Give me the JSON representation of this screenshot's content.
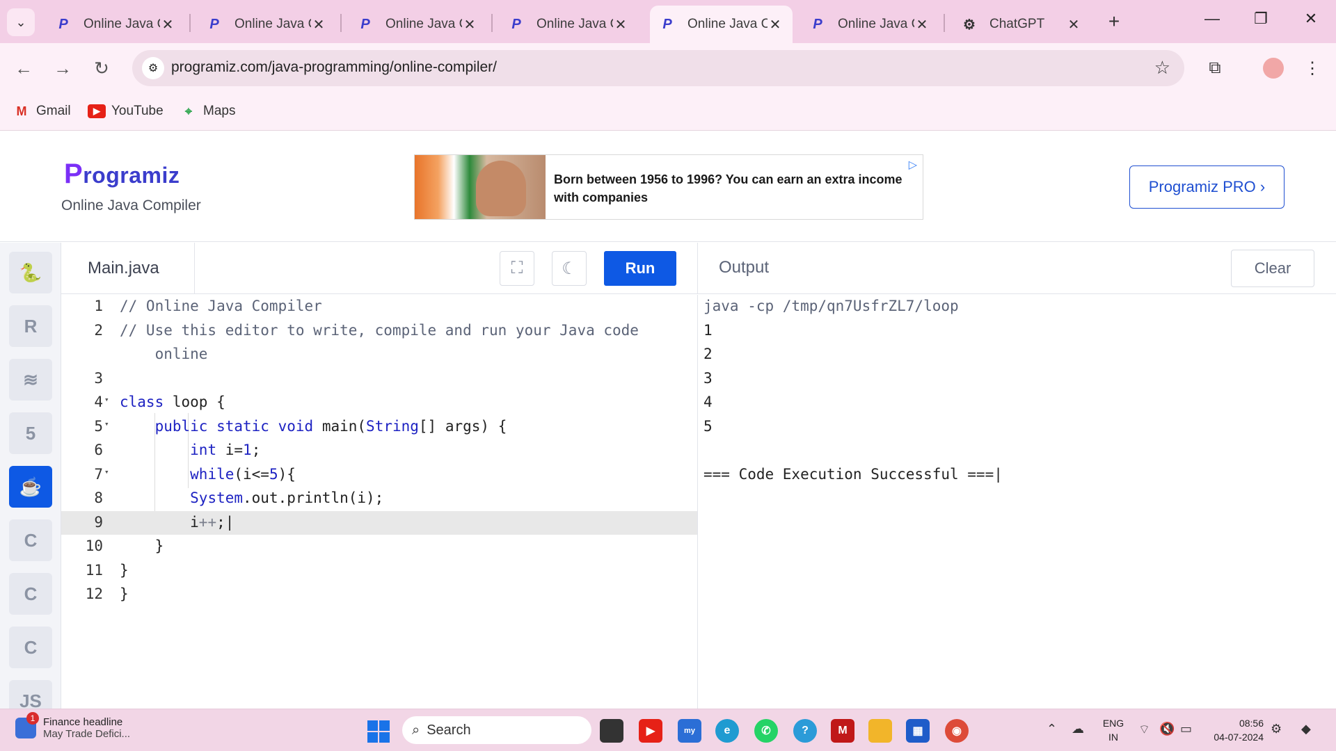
{
  "browser": {
    "tabs": [
      {
        "title": "Online Java C",
        "active": false
      },
      {
        "title": "Online Java C",
        "active": false
      },
      {
        "title": "Online Java C",
        "active": false
      },
      {
        "title": "Online Java C",
        "active": false
      },
      {
        "title": "Online Java C",
        "active": true
      },
      {
        "title": "Online Java C",
        "active": false
      },
      {
        "title": "ChatGPT",
        "active": false
      }
    ],
    "url": "programiz.com/java-programming/online-compiler/",
    "bookmarks": [
      {
        "label": "Gmail",
        "icon": "gmail-icon"
      },
      {
        "label": "YouTube",
        "icon": "youtube-icon"
      },
      {
        "label": "Maps",
        "icon": "maps-icon"
      }
    ]
  },
  "site": {
    "logo": "rogramiz",
    "logo_initial": "P",
    "subtitle": "Online Java Compiler",
    "ad_text": "Born between 1956 to 1996? You can earn an extra income with companies",
    "pro_button": "Programiz PRO ›"
  },
  "rail": {
    "items": [
      {
        "name": "python",
        "glyph": "🐍",
        "active": false
      },
      {
        "name": "r",
        "glyph": "R",
        "active": false
      },
      {
        "name": "sql",
        "glyph": "≋",
        "active": false
      },
      {
        "name": "html",
        "glyph": "5",
        "active": false
      },
      {
        "name": "java",
        "glyph": "☕",
        "active": true
      },
      {
        "name": "c",
        "glyph": "C",
        "active": false
      },
      {
        "name": "cpp",
        "glyph": "C",
        "active": false
      },
      {
        "name": "csharp",
        "glyph": "C",
        "active": false
      },
      {
        "name": "js",
        "glyph": "JS",
        "active": false
      }
    ]
  },
  "editor": {
    "file_tab": "Main.java",
    "run_label": "Run",
    "current_line": 9,
    "lines": [
      {
        "n": "1",
        "fold": "",
        "html": "<span class='cm'>// Online Java Compiler</span>"
      },
      {
        "n": "2",
        "fold": "",
        "html": "<span class='cm'>// Use this editor to write, compile and run your Java code</span>"
      },
      {
        "n": "",
        "fold": "",
        "html": "<span class='cm'>    online</span>"
      },
      {
        "n": "3",
        "fold": "",
        "html": ""
      },
      {
        "n": "4",
        "fold": "▾",
        "html": "<span class='kw'>class</span> loop {"
      },
      {
        "n": "5",
        "fold": "▾",
        "html": "    <span class='kw'>public</span> <span class='kw'>static</span> <span class='kw'>void</span> main(<span class='kw'>String</span>[] args) {"
      },
      {
        "n": "6",
        "fold": "",
        "html": "        <span class='kw'>int</span> i=<span class='num'>1</span>;"
      },
      {
        "n": "7",
        "fold": "▾",
        "html": "        <span class='kw'>while</span>(i&lt;=<span class='num'>5</span>){"
      },
      {
        "n": "8",
        "fold": "",
        "html": "        <span class='kw'>System</span>.out.println(i);"
      },
      {
        "n": "9",
        "fold": "",
        "html": "        i<span class='op'>++</span>;|"
      },
      {
        "n": "10",
        "fold": "",
        "html": "    }"
      },
      {
        "n": "11",
        "fold": "",
        "html": "}"
      },
      {
        "n": "12",
        "fold": "",
        "html": "}"
      }
    ]
  },
  "output": {
    "title": "Output",
    "clear_label": "Clear",
    "lines": [
      "java -cp /tmp/qn7UsfrZL7/loop",
      "1",
      "2",
      "3",
      "4",
      "5",
      "",
      "=== Code Execution Successful ===|"
    ]
  },
  "taskbar": {
    "news_title": "Finance headline",
    "news_sub": "May Trade Defici...",
    "news_badge": "1",
    "search_label": "Search",
    "lang_top": "ENG",
    "lang_bottom": "IN",
    "time": "08:56",
    "date": "04-07-2024"
  }
}
